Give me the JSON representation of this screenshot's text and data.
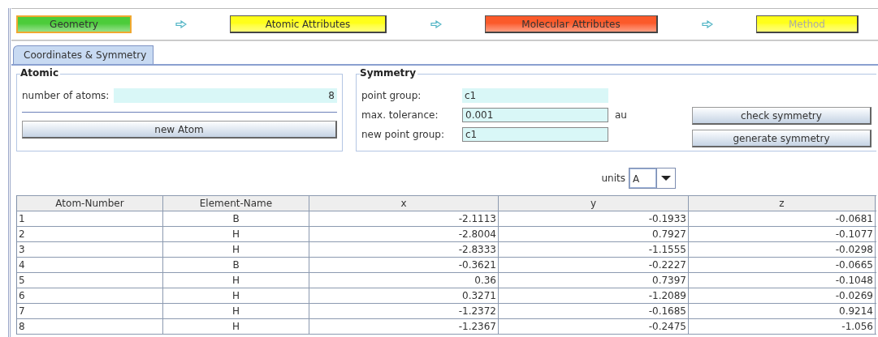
{
  "workflow": [
    {
      "label": "Geometry",
      "color": "#4ccc3a",
      "selected": true,
      "disabled": false
    },
    {
      "label": "Atomic Attributes",
      "color": "#ffff1a",
      "selected": false,
      "disabled": false
    },
    {
      "label": "Molecular Attributes",
      "color": "#fb5a2a",
      "selected": false,
      "disabled": false
    },
    {
      "label": "Method",
      "color": "#ffff1a",
      "selected": false,
      "disabled": true
    }
  ],
  "tabs": [
    {
      "label": "Coordinates & Symmetry",
      "selected": true
    }
  ],
  "atomic": {
    "title": "Atomic",
    "number_of_atoms": {
      "label": "number of atoms:",
      "value": "8"
    },
    "new_atom_button": "new Atom"
  },
  "symmetry": {
    "title": "Symmetry",
    "point_group": {
      "label": "point group:",
      "value": "c1"
    },
    "max_tolerance": {
      "label": "max. tolerance:",
      "value": "0.001",
      "unit": "au"
    },
    "new_point_group": {
      "label": "new point group:",
      "value": "c1"
    },
    "buttons": [
      "check symmetry",
      "generate symmetry"
    ]
  },
  "units": {
    "label": "units",
    "value": "A"
  },
  "table": {
    "columns": [
      "Atom-Number",
      "Element-Name",
      "x",
      "y",
      "z"
    ],
    "rows": [
      [
        "1",
        "B",
        "-2.1113",
        "-0.1933",
        "-0.0681"
      ],
      [
        "2",
        "H",
        "-2.8004",
        "0.7927",
        "-0.1077"
      ],
      [
        "3",
        "H",
        "-2.8333",
        "-1.1555",
        "-0.0298"
      ],
      [
        "4",
        "B",
        "-0.3621",
        "-0.2227",
        "-0.0665"
      ],
      [
        "5",
        "H",
        "0.36",
        "0.7397",
        "-0.1048"
      ],
      [
        "6",
        "H",
        "0.3271",
        "-1.2089",
        "-0.0269"
      ],
      [
        "7",
        "H",
        "-1.2372",
        "-0.1685",
        "0.9214"
      ],
      [
        "8",
        "H",
        "-1.2367",
        "-0.2475",
        "-1.056"
      ]
    ]
  }
}
